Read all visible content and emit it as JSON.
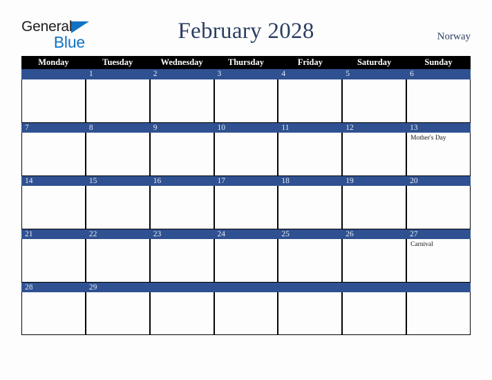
{
  "brand": {
    "name_part1": "General",
    "name_part2": "Blue",
    "triangle_icon": "triangle-icon",
    "color_dark": "#1c1c1c",
    "color_blue": "#1272c4"
  },
  "header": {
    "title": "February 2028",
    "country": "Norway",
    "title_color": "#2c3e63"
  },
  "theme": {
    "header_row_bg": "#000000",
    "header_row_text": "#ffffff",
    "day_bar_bg": "#2f5191",
    "day_bar_text": "#e8ecf5",
    "cell_bg": "#fdfdfd",
    "grid_line": "#000000",
    "page_bg": "#fdfdfd"
  },
  "weekday_headers": [
    "Monday",
    "Tuesday",
    "Wednesday",
    "Thursday",
    "Friday",
    "Saturday",
    "Sunday"
  ],
  "weeks": [
    {
      "days": [
        {
          "date": "",
          "events": []
        },
        {
          "date": "1",
          "events": []
        },
        {
          "date": "2",
          "events": []
        },
        {
          "date": "3",
          "events": []
        },
        {
          "date": "4",
          "events": []
        },
        {
          "date": "5",
          "events": []
        },
        {
          "date": "6",
          "events": []
        }
      ]
    },
    {
      "days": [
        {
          "date": "7",
          "events": []
        },
        {
          "date": "8",
          "events": []
        },
        {
          "date": "9",
          "events": []
        },
        {
          "date": "10",
          "events": []
        },
        {
          "date": "11",
          "events": []
        },
        {
          "date": "12",
          "events": []
        },
        {
          "date": "13",
          "events": [
            "Mother's Day"
          ]
        }
      ]
    },
    {
      "days": [
        {
          "date": "14",
          "events": []
        },
        {
          "date": "15",
          "events": []
        },
        {
          "date": "16",
          "events": []
        },
        {
          "date": "17",
          "events": []
        },
        {
          "date": "18",
          "events": []
        },
        {
          "date": "19",
          "events": []
        },
        {
          "date": "20",
          "events": []
        }
      ]
    },
    {
      "days": [
        {
          "date": "21",
          "events": []
        },
        {
          "date": "22",
          "events": []
        },
        {
          "date": "23",
          "events": []
        },
        {
          "date": "24",
          "events": []
        },
        {
          "date": "25",
          "events": []
        },
        {
          "date": "26",
          "events": []
        },
        {
          "date": "27",
          "events": [
            "Carnival"
          ]
        }
      ]
    },
    {
      "days": [
        {
          "date": "28",
          "events": []
        },
        {
          "date": "29",
          "events": []
        },
        {
          "date": "",
          "events": []
        },
        {
          "date": "",
          "events": []
        },
        {
          "date": "",
          "events": []
        },
        {
          "date": "",
          "events": []
        },
        {
          "date": "",
          "events": []
        }
      ]
    }
  ]
}
